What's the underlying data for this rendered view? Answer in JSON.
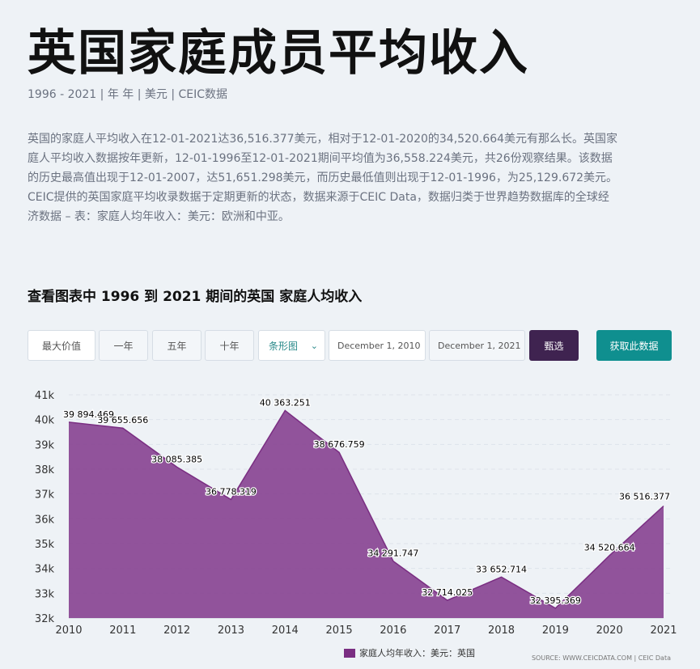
{
  "page": {
    "title": "英国家庭成员平均收入",
    "subtitle": "1996 - 2021 | 年 年 | 美元 | CEIC数据",
    "description": "英国的家庭人平均收入在12-01-2021达36,516.377美元，相对于12-01-2020的34,520.664美元有那么长。英国家庭人平均收入数据按年更新，12-01-1996至12-01-2021期间平均值为36,558.224美元，共26份观察结果。该数据的历史最高值出现于12-01-2007，达51,651.298美元，而历史最低值则出现于12-01-1996，为25,129.672美元。CEIC提供的英国家庭平均收录数据于定期更新的状态，数据来源于CEIC Data，数据归类于世界趋势数据库的全球经济数据 – 表：家庭人均年收入：美元：欧洲和中亚。",
    "section_heading": "查看图表中 1996 到 2021 期间的英国 家庭人均收入"
  },
  "controls": {
    "max": "最大价值",
    "one_year": "一年",
    "five_year": "五年",
    "ten_year": "十年",
    "chart_type": "条形图",
    "date_from": "December 1, 2010",
    "date_to": "December 1, 2021",
    "filter": "甄选",
    "get_data": "获取此数据"
  },
  "colors": {
    "area_fill": "#8b4a96",
    "line": "#7a2e82",
    "filter_button": "#3f2350",
    "get_data_button": "#0f8f8f"
  },
  "chart_data": {
    "type": "area",
    "x": [
      "2010",
      "2011",
      "2012",
      "2013",
      "2014",
      "2015",
      "2016",
      "2017",
      "2018",
      "2019",
      "2020",
      "2021"
    ],
    "series": [
      {
        "name": "家庭人均年收入：美元：英国",
        "values": [
          39894.469,
          39655.656,
          38085.385,
          36778.319,
          40363.251,
          38676.759,
          34291.747,
          32714.025,
          33652.714,
          32395.369,
          34520.664,
          36516.377
        ],
        "labels": [
          "39 894.469",
          "39 655.656",
          "38 085.385",
          "36 778.319",
          "40 363.251",
          "38 676.759",
          "34 291.747",
          "32 714.025",
          "33 652.714",
          "32 395.369",
          "34 520.664",
          "36 516.377"
        ]
      }
    ],
    "y_ticks": [
      "41k",
      "40k",
      "39k",
      "38k",
      "37k",
      "36k",
      "35k",
      "34k",
      "33k",
      "32k"
    ],
    "ylim": [
      32000,
      41000
    ],
    "grid": true,
    "legend_position": "bottom",
    "source": "SOURCE: WWW.CEICDATA.COM | CEIC Data"
  }
}
